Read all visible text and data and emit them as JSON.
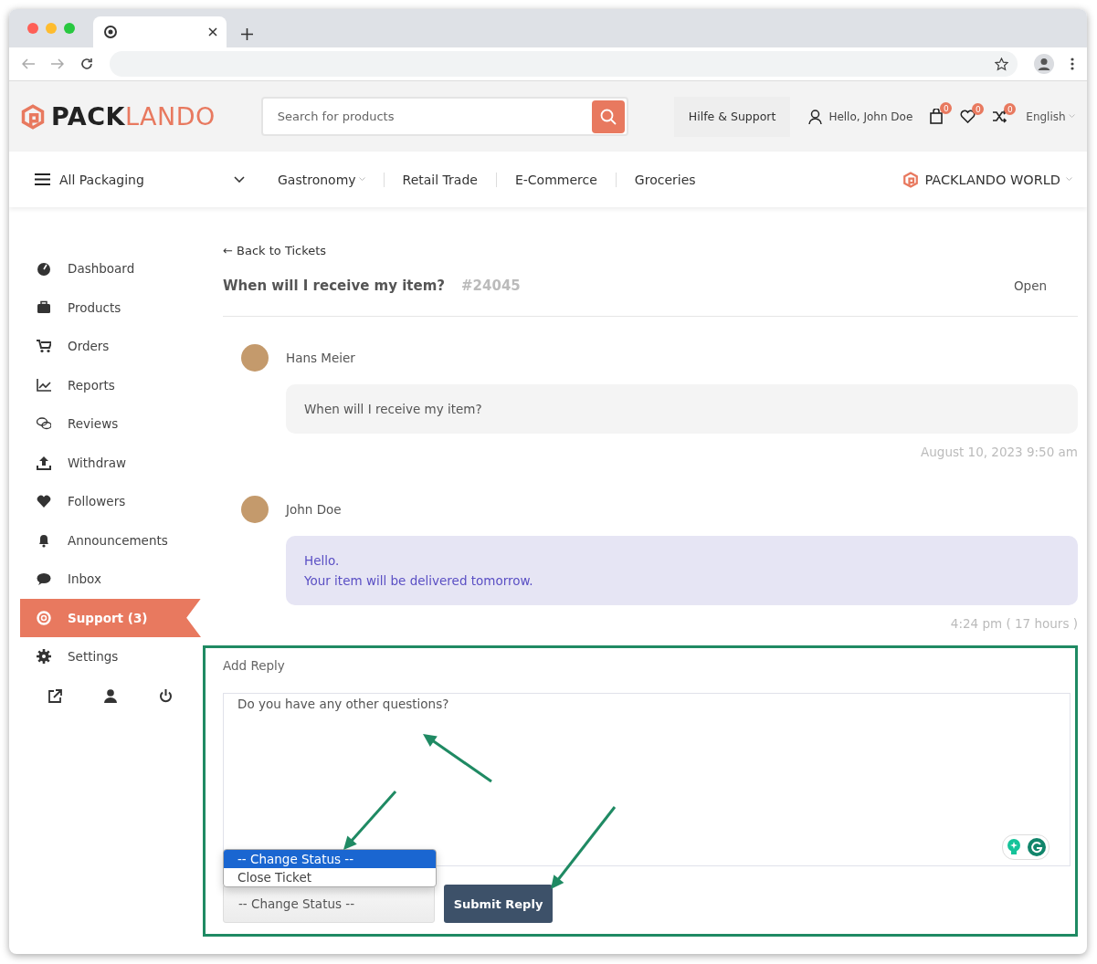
{
  "header": {
    "logo": {
      "first": "PACK",
      "second": "LANDO"
    },
    "search": {
      "placeholder": "Search for products"
    },
    "support_button": "Hilfe & Support",
    "greeting": "Hello, John Doe",
    "counters": [
      {
        "kind": "bag",
        "count": "0"
      },
      {
        "kind": "heart",
        "count": "0"
      },
      {
        "kind": "compare",
        "count": "0"
      }
    ],
    "language": "English"
  },
  "nav": {
    "all_packaging": "All Packaging",
    "items": [
      {
        "label": "Gastronomy",
        "dropdown": true
      },
      {
        "label": "Retail Trade",
        "dropdown": false
      },
      {
        "label": "E-Commerce",
        "dropdown": false
      },
      {
        "label": "Groceries",
        "dropdown": false
      }
    ],
    "world": "PACKLANDO WORLD"
  },
  "sidebar": {
    "items": [
      {
        "kind": "dashboard",
        "label": "Dashboard",
        "selected": false
      },
      {
        "kind": "products",
        "label": "Products",
        "selected": false
      },
      {
        "kind": "orders",
        "label": "Orders",
        "selected": false
      },
      {
        "kind": "reports",
        "label": "Reports",
        "selected": false
      },
      {
        "kind": "reviews",
        "label": "Reviews",
        "selected": false
      },
      {
        "kind": "withdraw",
        "label": "Withdraw",
        "selected": false
      },
      {
        "kind": "followers",
        "label": "Followers",
        "selected": false
      },
      {
        "kind": "announcements",
        "label": "Announcements",
        "selected": false
      },
      {
        "kind": "inbox",
        "label": "Inbox",
        "selected": false
      },
      {
        "kind": "support",
        "label": "Support (3)",
        "selected": true
      },
      {
        "kind": "settings",
        "label": "Settings",
        "selected": false
      }
    ]
  },
  "ticket": {
    "back_link": "← Back to Tickets",
    "title": "When will I receive my item?",
    "number": "#24045",
    "status": "Open",
    "messages": [
      {
        "kind": "incoming",
        "author": "Hans Meier",
        "lines": [
          "When will I receive my item?"
        ],
        "time": "August 10, 2023 9:50 am"
      },
      {
        "kind": "outgoing",
        "author": "John Doe",
        "lines": [
          "Hello.",
          "Your item will be delivered tomorrow."
        ],
        "time": "4:24 pm ( 17 hours )"
      }
    ]
  },
  "reply": {
    "label": "Add Reply",
    "value": "Do you have any other questions?",
    "status_select": "-- Change Status --",
    "status_options": [
      {
        "label": "-- Change Status --",
        "selected": true
      },
      {
        "label": "Close Ticket",
        "selected": false
      }
    ],
    "submit": "Submit Reply"
  }
}
